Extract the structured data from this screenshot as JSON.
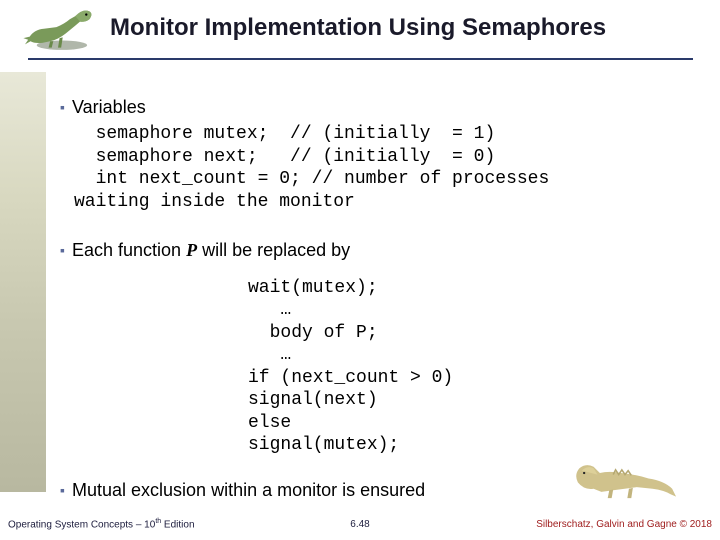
{
  "title": "Monitor Implementation Using Semaphores",
  "bullets": {
    "b1": "Variables",
    "b2_prefix": "Each function ",
    "b2_var": "P",
    "b2_suffix": "  will be replaced by",
    "b3": "Mutual exclusion within a monitor is ensured"
  },
  "code1": "  semaphore mutex;  // (initially  = 1)\n  semaphore next;   // (initially  = 0)\n  int next_count = 0; // number of processes\nwaiting inside the monitor",
  "code2": "wait(mutex);\n   …\n  body of P;\n   …\nif (next_count > 0)\nsignal(next)\nelse\nsignal(mutex);",
  "footer": {
    "left_a": "Operating System Concepts – 10",
    "left_b": " Edition",
    "left_sup": "th",
    "center": "6.48",
    "right": "Silberschatz, Galvin and Gagne © 2018"
  }
}
